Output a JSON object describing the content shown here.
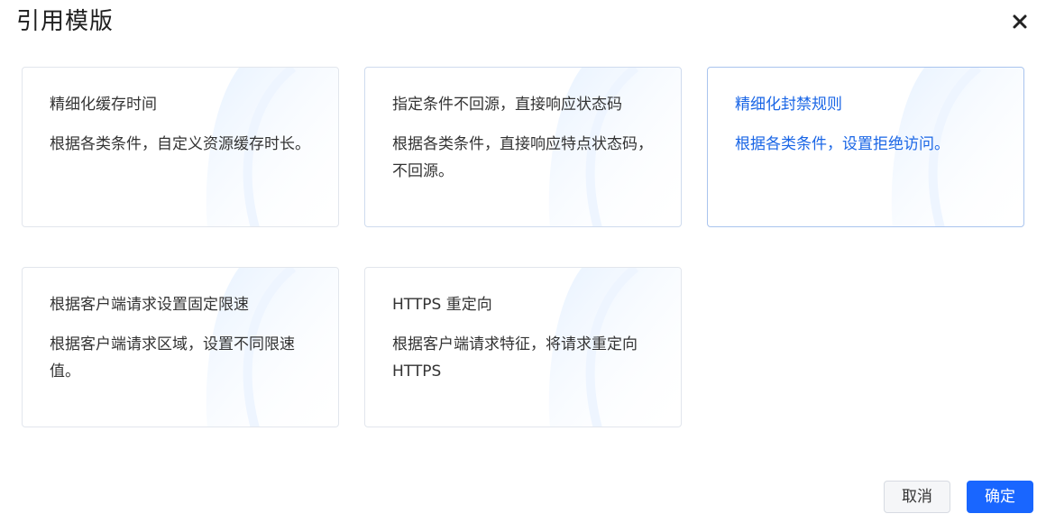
{
  "dialog": {
    "title": "引用模版"
  },
  "templates": [
    {
      "title": "精细化缓存时间",
      "description": "根据各类条件，自定义资源缓存时长。",
      "selected": false
    },
    {
      "title": "指定条件不回源，直接响应状态码",
      "description": "根据各类条件，直接响应特点状态码，不回源。",
      "selected": false
    },
    {
      "title": "精细化封禁规则",
      "description": "根据各类条件，设置拒绝访问。",
      "selected": true
    },
    {
      "title": "根据客户端请求设置固定限速",
      "description": "根据客户端请求区域，设置不同限速值。",
      "selected": false
    },
    {
      "title": "HTTPS 重定向",
      "description": "根据客户端请求特征，将请求重定向 HTTPS",
      "selected": false
    }
  ],
  "footer": {
    "cancel_label": "取消",
    "confirm_label": "确定"
  },
  "colors": {
    "accent": "#1966ff",
    "selected_text": "#1a66e6",
    "text": "#333333"
  },
  "icons": {
    "close": "close-icon"
  }
}
